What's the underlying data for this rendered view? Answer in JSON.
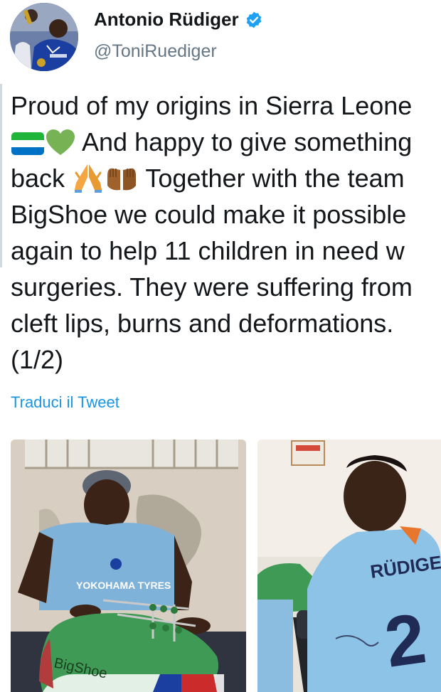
{
  "author": {
    "display_name": "Antonio Rüdiger",
    "handle": "@ToniRuediger"
  },
  "tweet": {
    "lines": [
      {
        "before": "Proud of my origins in Sierra Leone",
        "after": ""
      },
      {
        "before": "",
        "after": " And happy to give something"
      },
      {
        "before": "back ",
        "after": " Together with the team"
      },
      {
        "before": "BigShoe we could make it possible",
        "after": ""
      },
      {
        "before": "again to help 11 children in need w",
        "after": ""
      },
      {
        "before": "surgeries. They were suffering from",
        "after": ""
      },
      {
        "before": "cleft lips, burns and deformations.",
        "after": ""
      },
      {
        "before": "(1/2)",
        "after": ""
      }
    ],
    "translate_label": "Traduci il Tweet"
  },
  "media": {
    "shoe_label": "BigShoe",
    "shirt_sponsor": "YOKOHAMA TYRES",
    "shirt_name": "RÜDIGER",
    "shirt_number": "2"
  },
  "colors": {
    "verified_blue": "#1da1f2",
    "link_blue": "#1b95e0",
    "flag_green": "#1eb53a",
    "flag_white": "#ffffff",
    "flag_blue": "#0072c6",
    "heart_green": "#77b255"
  },
  "icons": {
    "verified": "verified-badge-icon",
    "flag": "sierra-leone-flag-emoji",
    "heart": "green-heart-emoji",
    "pray": "folded-hands-emoji",
    "hands": "palms-up-together-emoji"
  }
}
